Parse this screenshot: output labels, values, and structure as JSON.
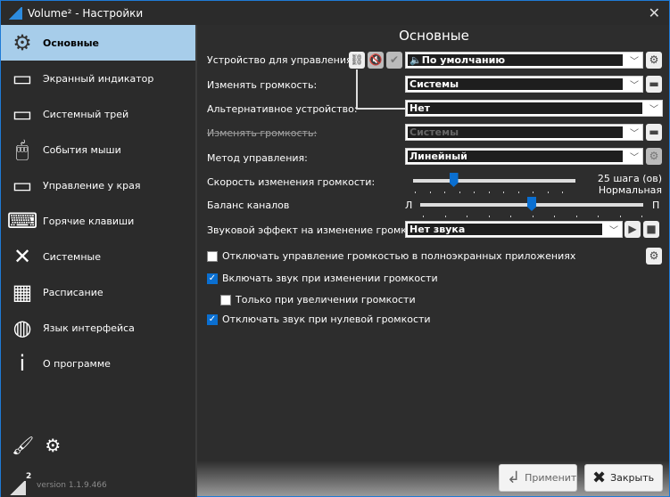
{
  "window": {
    "title": "Volume² - Настройки",
    "close": "✕"
  },
  "sidebar": {
    "items": [
      {
        "label": "Основные",
        "icon": "⚙",
        "name": "gear"
      },
      {
        "label": "Экранный индикатор",
        "icon": "▭",
        "name": "monitor"
      },
      {
        "label": "Системный трей",
        "icon": "▭",
        "name": "tray"
      },
      {
        "label": "События мыши",
        "icon": "🖱",
        "name": "mouse"
      },
      {
        "label": "Управление у края",
        "icon": "▭",
        "name": "screen-edge"
      },
      {
        "label": "Горячие клавиши",
        "icon": "⌨",
        "name": "keyboard"
      },
      {
        "label": "Системные",
        "icon": "✕",
        "name": "tools"
      },
      {
        "label": "Расписание",
        "icon": "▦",
        "name": "calendar"
      },
      {
        "label": "Язык интерфейса",
        "icon": "◍",
        "name": "globe"
      },
      {
        "label": "О программе",
        "icon": "i",
        "name": "info"
      }
    ],
    "version": "version 1.1.9.466",
    "logo_sup": "2"
  },
  "main": {
    "title": "Основные",
    "device_label": "Устройство для управления:",
    "device_value": "🔈По умолчанию",
    "change_volume_label": "Изменять громкость:",
    "change_volume_value": "Системы",
    "alt_device_label": "Альтернативное устройство:",
    "alt_device_value": "Нет",
    "change_volume2_label": "Изменять громкость:",
    "change_volume2_value": "Системы",
    "method_label": "Метод управления:",
    "method_value": "Линейный",
    "speed_label": "Скорость изменения громкости:",
    "speed_value": "25 шага (ов)",
    "speed_desc": "Нормальная",
    "speed_fraction": 0.25,
    "balance_label": "Баланс каналов",
    "balance_left": "Л",
    "balance_right": "П",
    "balance_fraction": 0.5,
    "effect_label": "Звуковой эффект на изменение громкости:",
    "effect_value": "Нет звука",
    "checkboxes": [
      {
        "label": "Отключать управление громкостью в полноэкранных приложениях",
        "checked": false
      },
      {
        "label": "Включать звук при изменении громкости",
        "checked": true
      },
      {
        "label": "Только при увеличении громкости",
        "checked": false
      },
      {
        "label": "Отключать звук при нулевой громкости",
        "checked": true
      }
    ]
  },
  "buttons": {
    "apply": "Применить",
    "close": "Закрыть"
  }
}
